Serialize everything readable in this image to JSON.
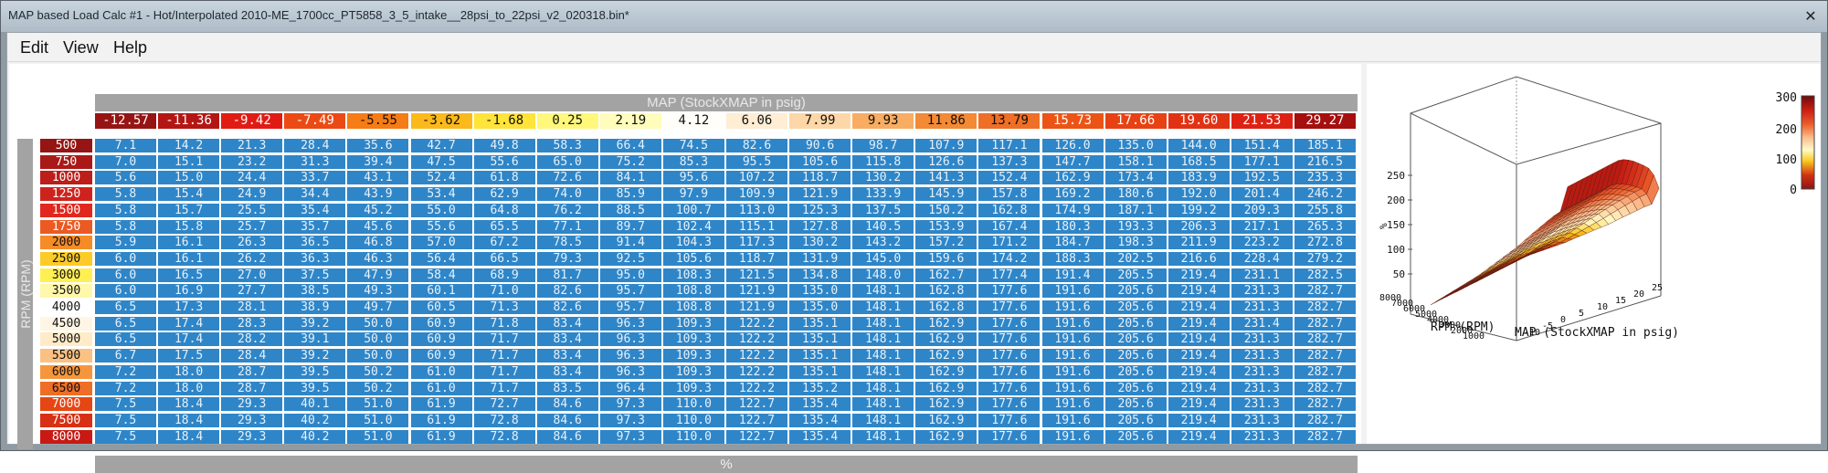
{
  "window": {
    "title": "MAP based Load Calc #1 - Hot/Interpolated 2010-ME_1700cc_PT5858_3_5_intake__28psi_to_22psi_v2_020318.bin*",
    "close_glyph": "✕"
  },
  "menu": [
    {
      "label": "Edit"
    },
    {
      "label": "View"
    },
    {
      "label": "Help"
    }
  ],
  "table": {
    "x_axis_label": "MAP (StockXMAP in psig)",
    "y_axis_label": "RPM (RPM)",
    "value_label": "%",
    "x_headers": [
      "-12.57",
      "-11.36",
      "-9.42",
      "-7.49",
      "-5.55",
      "-3.62",
      "-1.68",
      "0.25",
      "2.19",
      "4.12",
      "6.06",
      "7.99",
      "9.93",
      "11.86",
      "13.79",
      "15.73",
      "17.66",
      "19.60",
      "21.53",
      "29.27"
    ],
    "y_headers": [
      "500",
      "750",
      "1000",
      "1250",
      "1500",
      "1750",
      "2000",
      "2500",
      "3000",
      "3500",
      "4000",
      "4500",
      "5000",
      "5500",
      "6000",
      "6500",
      "7000",
      "7500",
      "8000"
    ],
    "rows": [
      [
        "7.1",
        "14.2",
        "21.3",
        "28.4",
        "35.6",
        "42.7",
        "49.8",
        "58.3",
        "66.4",
        "74.5",
        "82.6",
        "90.6",
        "98.7",
        "107.9",
        "117.1",
        "126.0",
        "135.0",
        "144.0",
        "151.4",
        "185.1"
      ],
      [
        "7.0",
        "15.1",
        "23.2",
        "31.3",
        "39.4",
        "47.5",
        "55.6",
        "65.0",
        "75.2",
        "85.3",
        "95.5",
        "105.6",
        "115.8",
        "126.6",
        "137.3",
        "147.7",
        "158.1",
        "168.5",
        "177.1",
        "216.5"
      ],
      [
        "5.6",
        "15.0",
        "24.4",
        "33.7",
        "43.1",
        "52.4",
        "61.8",
        "72.6",
        "84.1",
        "95.6",
        "107.2",
        "118.7",
        "130.2",
        "141.3",
        "152.4",
        "162.9",
        "173.4",
        "183.9",
        "192.5",
        "235.3"
      ],
      [
        "5.8",
        "15.4",
        "24.9",
        "34.4",
        "43.9",
        "53.4",
        "62.9",
        "74.0",
        "85.9",
        "97.9",
        "109.9",
        "121.9",
        "133.9",
        "145.9",
        "157.8",
        "169.2",
        "180.6",
        "192.0",
        "201.4",
        "246.2"
      ],
      [
        "5.8",
        "15.7",
        "25.5",
        "35.4",
        "45.2",
        "55.0",
        "64.8",
        "76.2",
        "88.5",
        "100.7",
        "113.0",
        "125.3",
        "137.5",
        "150.2",
        "162.8",
        "174.9",
        "187.1",
        "199.2",
        "209.3",
        "255.8"
      ],
      [
        "5.8",
        "15.8",
        "25.7",
        "35.7",
        "45.6",
        "55.6",
        "65.5",
        "77.1",
        "89.7",
        "102.4",
        "115.1",
        "127.8",
        "140.5",
        "153.9",
        "167.4",
        "180.3",
        "193.3",
        "206.3",
        "217.1",
        "265.3"
      ],
      [
        "5.9",
        "16.1",
        "26.3",
        "36.5",
        "46.8",
        "57.0",
        "67.2",
        "78.5",
        "91.4",
        "104.3",
        "117.3",
        "130.2",
        "143.2",
        "157.2",
        "171.2",
        "184.7",
        "198.3",
        "211.9",
        "223.2",
        "272.8"
      ],
      [
        "6.0",
        "16.1",
        "26.2",
        "36.3",
        "46.3",
        "56.4",
        "66.5",
        "79.3",
        "92.5",
        "105.6",
        "118.7",
        "131.9",
        "145.0",
        "159.6",
        "174.2",
        "188.3",
        "202.5",
        "216.6",
        "228.4",
        "279.2"
      ],
      [
        "6.0",
        "16.5",
        "27.0",
        "37.5",
        "47.9",
        "58.4",
        "68.9",
        "81.7",
        "95.0",
        "108.3",
        "121.5",
        "134.8",
        "148.0",
        "162.7",
        "177.4",
        "191.4",
        "205.5",
        "219.4",
        "231.1",
        "282.5"
      ],
      [
        "6.0",
        "16.9",
        "27.7",
        "38.5",
        "49.3",
        "60.1",
        "71.0",
        "82.6",
        "95.7",
        "108.8",
        "121.9",
        "135.0",
        "148.1",
        "162.8",
        "177.6",
        "191.6",
        "205.6",
        "219.4",
        "231.3",
        "282.7"
      ],
      [
        "6.5",
        "17.3",
        "28.1",
        "38.9",
        "49.7",
        "60.5",
        "71.3",
        "82.6",
        "95.7",
        "108.8",
        "121.9",
        "135.0",
        "148.1",
        "162.8",
        "177.6",
        "191.6",
        "205.6",
        "219.4",
        "231.3",
        "282.7"
      ],
      [
        "6.5",
        "17.4",
        "28.3",
        "39.2",
        "50.0",
        "60.9",
        "71.8",
        "83.4",
        "96.3",
        "109.3",
        "122.2",
        "135.1",
        "148.1",
        "162.9",
        "177.6",
        "191.6",
        "205.6",
        "219.4",
        "231.4",
        "282.7"
      ],
      [
        "6.5",
        "17.4",
        "28.2",
        "39.1",
        "50.0",
        "60.9",
        "71.7",
        "83.4",
        "96.3",
        "109.3",
        "122.2",
        "135.1",
        "148.1",
        "162.9",
        "177.6",
        "191.6",
        "205.6",
        "219.4",
        "231.3",
        "282.7"
      ],
      [
        "6.7",
        "17.5",
        "28.4",
        "39.2",
        "50.0",
        "60.9",
        "71.7",
        "83.4",
        "96.3",
        "109.3",
        "122.2",
        "135.1",
        "148.1",
        "162.9",
        "177.6",
        "191.6",
        "205.6",
        "219.4",
        "231.3",
        "282.7"
      ],
      [
        "7.2",
        "18.0",
        "28.7",
        "39.5",
        "50.2",
        "61.0",
        "71.7",
        "83.4",
        "96.3",
        "109.3",
        "122.2",
        "135.1",
        "148.1",
        "162.9",
        "177.6",
        "191.6",
        "205.6",
        "219.4",
        "231.3",
        "282.7"
      ],
      [
        "7.2",
        "18.0",
        "28.7",
        "39.5",
        "50.2",
        "61.0",
        "71.7",
        "83.5",
        "96.4",
        "109.3",
        "122.2",
        "135.2",
        "148.1",
        "162.9",
        "177.6",
        "191.6",
        "205.6",
        "219.4",
        "231.3",
        "282.7"
      ],
      [
        "7.5",
        "18.4",
        "29.3",
        "40.1",
        "51.0",
        "61.9",
        "72.7",
        "84.6",
        "97.3",
        "110.0",
        "122.7",
        "135.4",
        "148.1",
        "162.9",
        "177.6",
        "191.6",
        "205.6",
        "219.4",
        "231.3",
        "282.7"
      ],
      [
        "7.5",
        "18.4",
        "29.3",
        "40.2",
        "51.0",
        "61.9",
        "72.8",
        "84.6",
        "97.3",
        "110.0",
        "122.7",
        "135.4",
        "148.1",
        "162.9",
        "177.6",
        "191.6",
        "205.6",
        "219.4",
        "231.3",
        "282.7"
      ],
      [
        "7.5",
        "18.4",
        "29.3",
        "40.2",
        "51.0",
        "61.9",
        "72.8",
        "84.6",
        "97.3",
        "110.0",
        "122.7",
        "135.4",
        "148.1",
        "162.9",
        "177.6",
        "191.6",
        "205.6",
        "219.4",
        "231.3",
        "282.7"
      ]
    ]
  },
  "plot": {
    "z_ticks": [
      "250",
      "200",
      "150",
      "100",
      "50"
    ],
    "z_label": "%",
    "rpm_ticks": [
      "8000",
      "7000",
      "6000",
      "5000",
      "4000",
      "3000",
      "2000",
      "1000"
    ],
    "map_ticks": [
      "-10",
      "-5",
      "0",
      "5",
      "10",
      "15",
      "20",
      "25"
    ],
    "x_label": "RPM (RPM)",
    "y_label": "MAP (StockXMAP in psig)",
    "colorbar_ticks": [
      "300",
      "200",
      "100",
      "0"
    ]
  }
}
